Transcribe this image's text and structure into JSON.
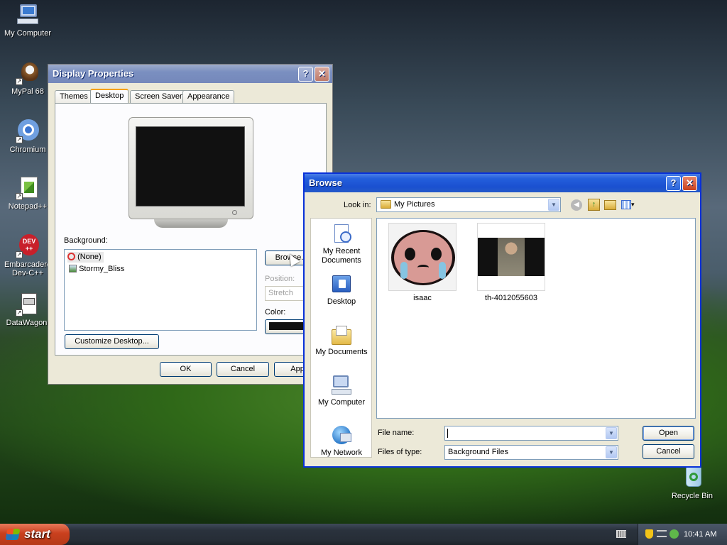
{
  "desktop": {
    "icons": [
      {
        "label": "My Computer",
        "icon": "my-computer-icon"
      },
      {
        "label": "MyPal 68",
        "icon": "mypal-icon"
      },
      {
        "label": "Chromium",
        "icon": "chromium-icon"
      },
      {
        "label": "Notepad++",
        "icon": "notepad-plus-plus-icon"
      },
      {
        "label_line1": "Embarcadero",
        "label_line2": "Dev-C++",
        "icon": "devcpp-icon",
        "badge": "DEV\n++"
      },
      {
        "label": "DataWagon.",
        "icon": "datawagon-icon"
      },
      {
        "label": "Recycle Bin",
        "icon": "recycle-bin-icon"
      }
    ]
  },
  "display_properties": {
    "title": "Display Properties",
    "help": "?",
    "close": "✕",
    "tabs": [
      "Themes",
      "Desktop",
      "Screen Saver",
      "Appearance"
    ],
    "background_label": "Background:",
    "backgrounds": [
      "(None)",
      "Stormy_Bliss"
    ],
    "browse_label": "Browse...",
    "position_label": "Position:",
    "position_value": "Stretch",
    "color_label": "Color:",
    "customize_label": "Customize Desktop...",
    "ok": "OK",
    "cancel": "Cancel",
    "apply": "Apply"
  },
  "browse": {
    "title": "Browse",
    "help": "?",
    "close": "✕",
    "look_in_label": "Look in:",
    "look_in_value": "My Pictures",
    "places": [
      {
        "line1": "My Recent",
        "line2": "Documents"
      },
      {
        "line1": "Desktop"
      },
      {
        "line1": "My Documents"
      },
      {
        "line1": "My Computer"
      },
      {
        "line1": "My Network"
      }
    ],
    "files": [
      {
        "name": "isaac"
      },
      {
        "name": "th-4012055603"
      }
    ],
    "file_name_label": "File name:",
    "file_name_value": "",
    "files_of_type_label": "Files of type:",
    "files_of_type_value": "Background Files",
    "open": "Open",
    "cancel": "Cancel"
  },
  "taskbar": {
    "start": "start",
    "time": "10:41 AM"
  },
  "colors": {
    "accent": "#245fdc",
    "start": "#3c9a32"
  }
}
